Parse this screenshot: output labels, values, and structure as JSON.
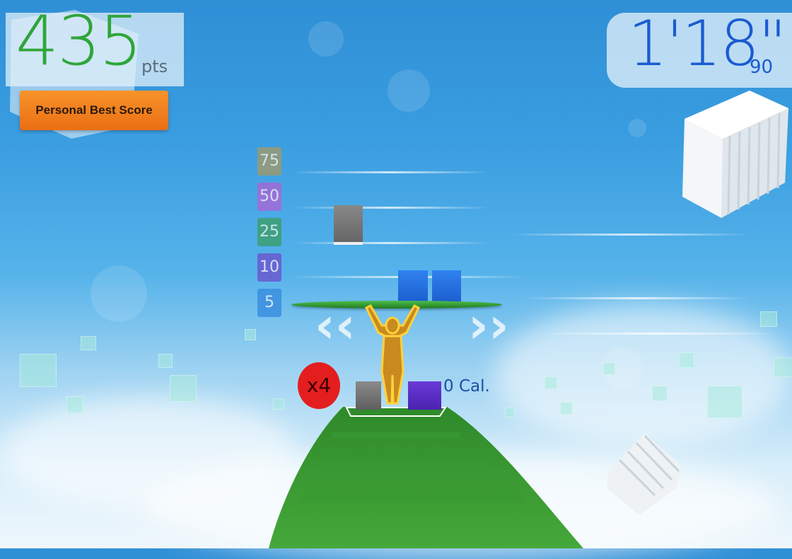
{
  "hud": {
    "score_value": "435",
    "score_unit": "pts",
    "best_badge": "Personal Best Score",
    "time_value": "1'18\"",
    "time_sub": "90"
  },
  "rails": [
    {
      "label": "75",
      "color": "#9a9a72"
    },
    {
      "label": "50",
      "color": "#a46ad6"
    },
    {
      "label": "25",
      "color": "#3d9f72"
    },
    {
      "label": "10",
      "color": "#6a5ad0"
    },
    {
      "label": "5",
      "color": "#3b8fe0"
    }
  ],
  "multiplier": "x4",
  "calories": "0 Cal.",
  "colors": {
    "score": "#2fa53a",
    "time": "#1a5bd0",
    "badge": "#ea6f14",
    "platform": "#3aa83a",
    "block_blue": "#1e6fe0",
    "block_purple": "#5a2fc4",
    "block_gray": "#777777"
  }
}
